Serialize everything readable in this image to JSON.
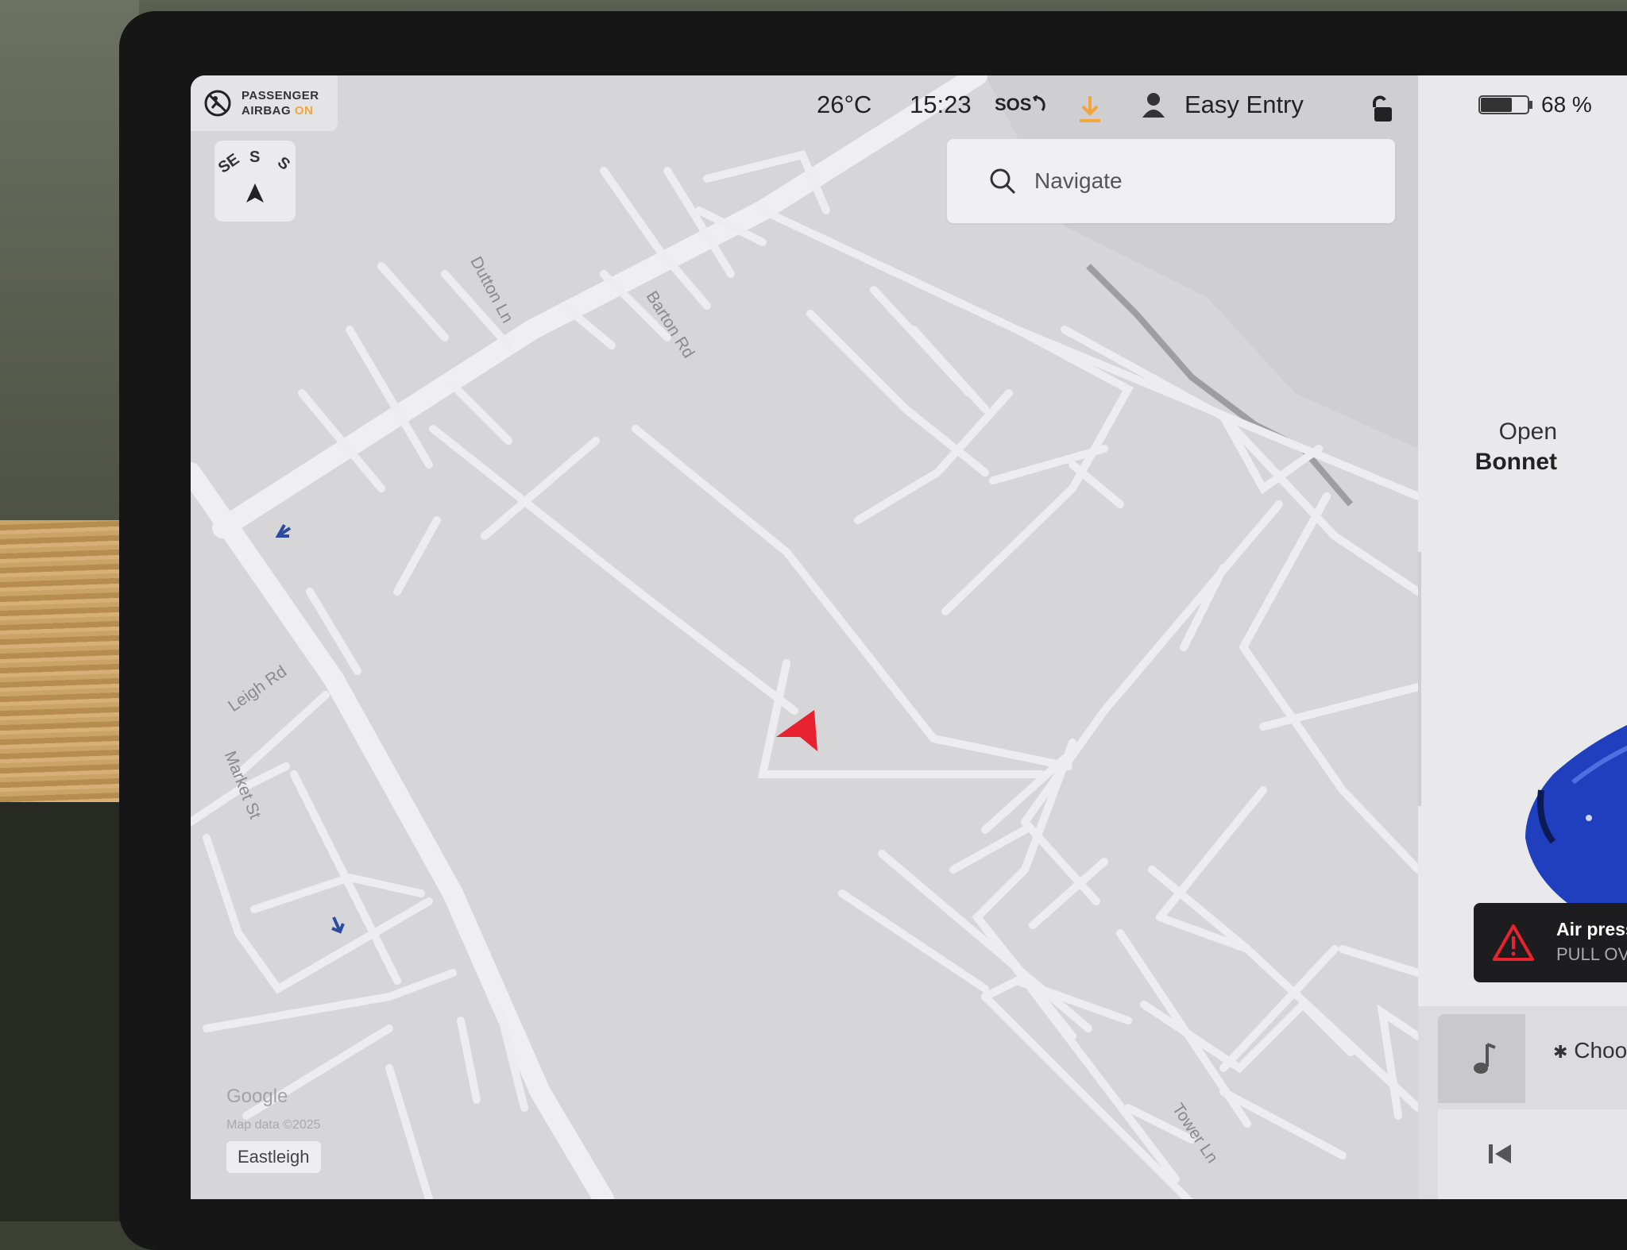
{
  "status_bar": {
    "airbag_label_line1": "PASSENGER",
    "airbag_label_line2": "AIRBAG",
    "airbag_state": "ON",
    "temperature": "26°C",
    "time": "15:23",
    "sos": "SOS",
    "profile": "Easy Entry",
    "battery_percent": "68 %",
    "battery_level": 0.68
  },
  "compass": {
    "left": "SE",
    "center": "S",
    "right": "S"
  },
  "search": {
    "placeholder": "Navigate"
  },
  "map": {
    "streets": [
      "Dutton Ln",
      "Barton Rd",
      "Leigh Rd",
      "Market St",
      "Tower Ln"
    ],
    "attribution": "Google",
    "map_data": "Map data ©2025",
    "area_label": "Eastleigh"
  },
  "side_panel": {
    "bonnet_line1": "Open",
    "bonnet_line2": "Bonnet",
    "alert_title": "Air press",
    "alert_sub": "PULL OV",
    "media_source": "Choos"
  },
  "colors": {
    "accent_orange": "#f3a53b",
    "nav_arrow": "#e8232f",
    "car_blue": "#1f3fbf"
  }
}
